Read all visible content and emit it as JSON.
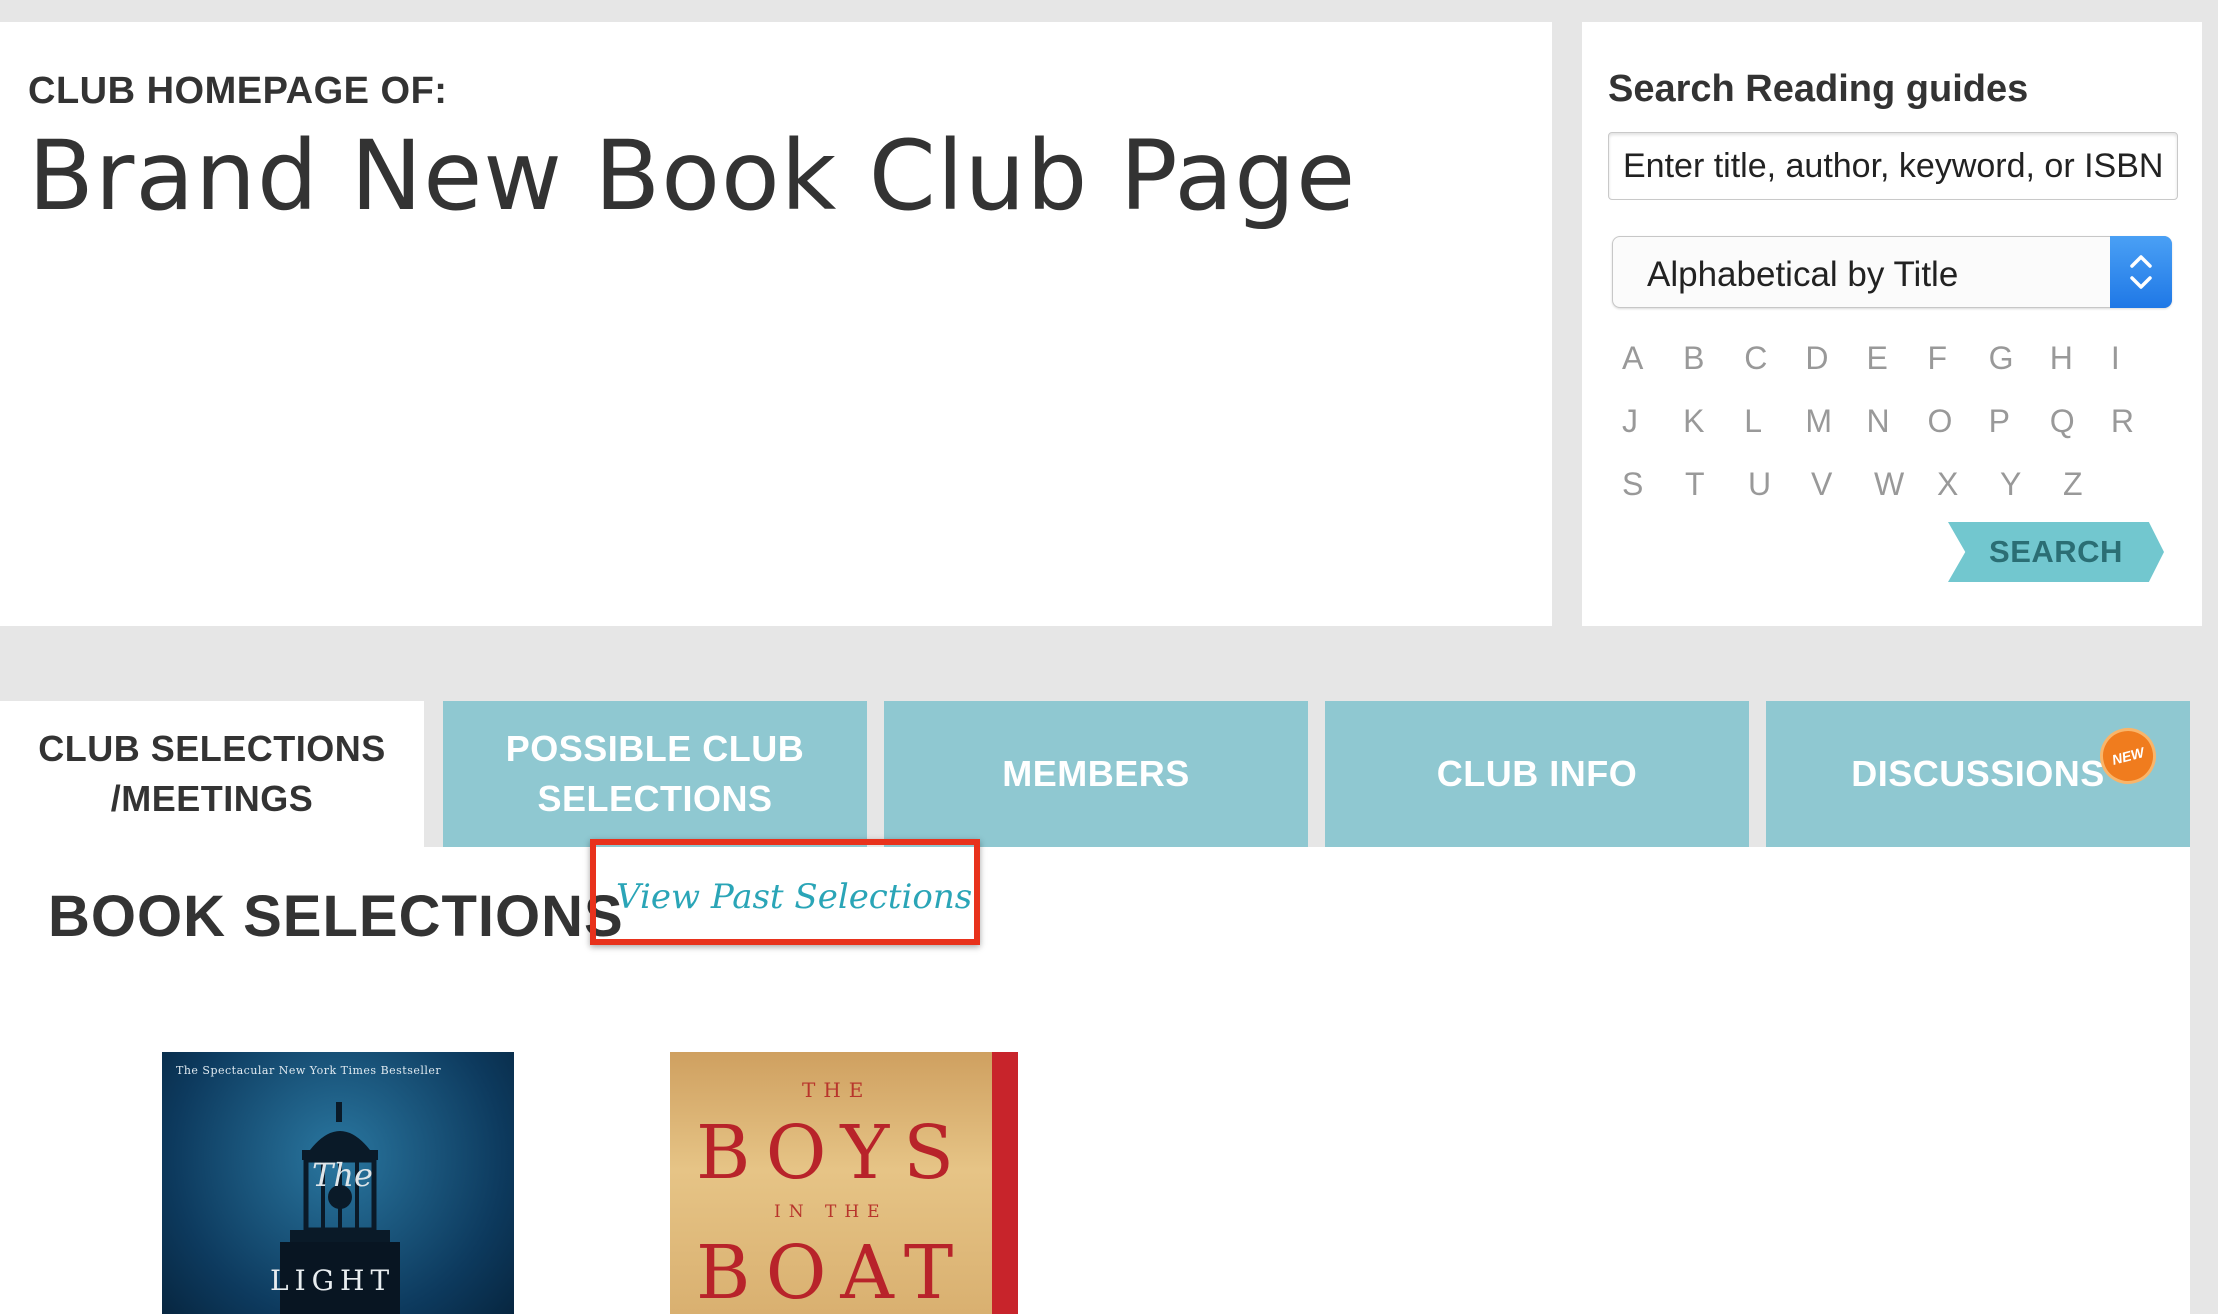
{
  "club": {
    "label": "CLUB HOMEPAGE OF:",
    "name": "Brand New Book Club Page"
  },
  "search": {
    "title": "Search Reading guides",
    "placeholder": "Enter title, author, keyword, or ISBN",
    "sort_selected": "Alphabetical by Title",
    "letters": [
      [
        "A",
        "B",
        "C",
        "D",
        "E",
        "F",
        "G",
        "H",
        "I"
      ],
      [
        "J",
        "K",
        "L",
        "M",
        "N",
        "O",
        "P",
        "Q",
        "R"
      ],
      [
        "S",
        "T",
        "U",
        "V",
        "W",
        "X",
        "Y",
        "Z"
      ]
    ],
    "button_label": "SEARCH"
  },
  "tabs": [
    {
      "line1": "CLUB SELECTIONS",
      "line2": "/MEETINGS"
    },
    {
      "line1": "POSSIBLE CLUB",
      "line2": "SELECTIONS"
    },
    {
      "line1": "MEMBERS",
      "line2": ""
    },
    {
      "line1": "CLUB INFO",
      "line2": ""
    },
    {
      "line1": "DISCUSSIONS",
      "line2": ""
    }
  ],
  "new_badge": "NEW",
  "content": {
    "title": "BOOK SELECTIONS",
    "past_link": "View Past Selections"
  },
  "books": {
    "light": {
      "top_line": "The Spectacular New York Times Bestseller",
      "the": "The",
      "title": "LIGHT"
    },
    "boat": {
      "the": "THE",
      "boys": "BOYS",
      "in_the": "IN THE",
      "boat": "BOAT"
    }
  },
  "colors": {
    "tab": "#8fc8d1",
    "accent_link": "#2aa5b7",
    "highlight": "#e8321c",
    "badge": "#f07c1e"
  }
}
